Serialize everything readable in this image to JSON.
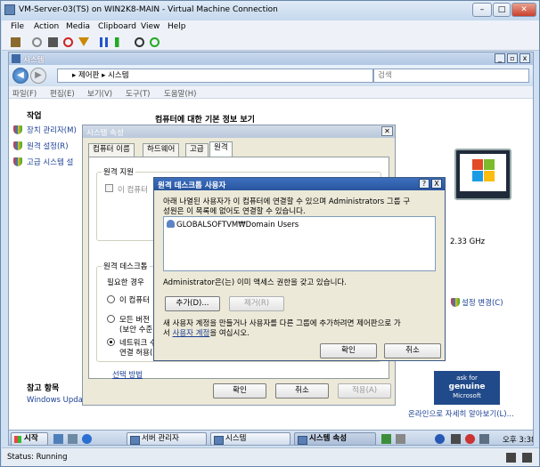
{
  "host": {
    "title": "VM-Server-03(TS) on WIN2K8-MAIN - Virtual Machine Connection",
    "menu": [
      "File",
      "Action",
      "Media",
      "Clipboard",
      "View",
      "Help"
    ],
    "status": "Status: Running"
  },
  "explorer": {
    "title": "시스템",
    "address": "▸ 제어판 ▸ 시스템",
    "search_placeholder": "검색",
    "menu": [
      "파일(F)",
      "편집(E)",
      "보기(V)",
      "도구(T)",
      "도움말(H)"
    ],
    "tasks_heading": "작업",
    "tasks": [
      "장치 관리자(M)",
      "원격 설정(R)",
      "고급 시스템 설"
    ],
    "main_heading": "컴퓨터에 대한 기본 정보 보기",
    "cpu_speed": "2.33 GHz",
    "change_settings": "설정 변경(C)",
    "see_also_heading": "참고 항목",
    "see_also_link": "Windows Upda",
    "genuine_line1": "ask for",
    "genuine_line2": "genuine",
    "genuine_line3": "Microsoft",
    "genuine_line4": "software",
    "genuine_link": "온라인으로 자세히 알아보기(L)..."
  },
  "sysprop": {
    "title": "시스템 속성",
    "tabs": [
      "컴퓨터 이름",
      "하드웨어",
      "고급",
      "원격"
    ],
    "remote_assist_label": "원격 지원",
    "remote_assist_check": "이 컴퓨터",
    "remote_desktop_label": "원격 데스크톱",
    "required_text": "필요한 경우",
    "opt1": "이 컴퓨터",
    "opt2a": "모든 버전",
    "opt2b": "(보안 수준",
    "opt3a": "네트워크 수",
    "opt3b": "연결 허용(",
    "choose_method": "선택 방법",
    "ok": "확인",
    "cancel": "취소",
    "apply": "적용(A)"
  },
  "rdu": {
    "title": "원격 데스크톱 사용자",
    "help": "?",
    "close": "X",
    "desc1": "아래 나열된 사용자가 이 컴퓨터에 연결할 수 있으며 Administrators 그룹 구",
    "desc2": "성원은 이 목록에 없어도 연결할 수 있습니다.",
    "users": [
      "GLOBALSOFTVM₩Domain Users"
    ],
    "admin_note": "Administrator은(는) 이미 액세스 권한을 갖고 있습니다.",
    "add": "추가(D)...",
    "remove": "제거(R)",
    "info1": "새 사용자 계정을 만들거나 사용자를 다른 그룹에 추가하려면 제어판으로 가",
    "info2_pre": "서 ",
    "info2_link": "사용자 계정",
    "info2_post": "을 여십시오.",
    "ok": "확인",
    "cancel": "취소"
  },
  "taskbar": {
    "start": "시작",
    "tasks": [
      "서버 관리자",
      "시스템",
      "시스템 속성"
    ],
    "clock": "오후 3:38"
  }
}
